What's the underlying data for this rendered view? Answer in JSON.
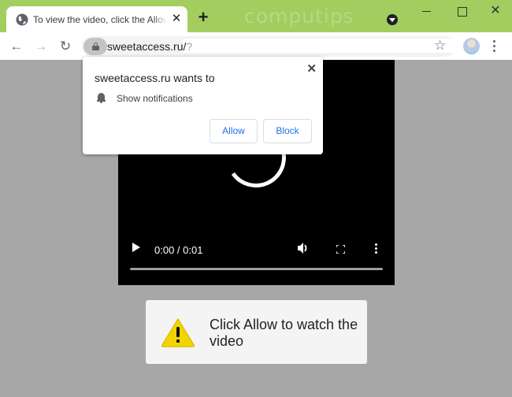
{
  "window": {
    "watermark": "computips",
    "controls": {
      "minimize": "minimize",
      "maximize": "maximize",
      "close": "✕"
    }
  },
  "tab": {
    "title": "To view the video, click the Allow",
    "close_glyph": "✕",
    "new_tab_glyph": "+"
  },
  "toolbar": {
    "back_glyph": "←",
    "forward_glyph": "→",
    "reload_glyph": "↻",
    "url_host": "sweetaccess.ru/",
    "url_rest": "?",
    "star_glyph": "☆"
  },
  "permission_prompt": {
    "title": "sweetaccess.ru wants to",
    "permission": "Show notifications",
    "allow_label": "Allow",
    "block_label": "Block",
    "close_glyph": "✕"
  },
  "video": {
    "time": "0:00 / 0:01",
    "progress_fraction": 0
  },
  "notice": {
    "text": "Click Allow to watch the video"
  },
  "colors": {
    "titlebar": "#a3cd5f",
    "page_bg": "#a7a7a7",
    "button_text": "#1a73e8",
    "warning_yellow": "#f2d500"
  }
}
